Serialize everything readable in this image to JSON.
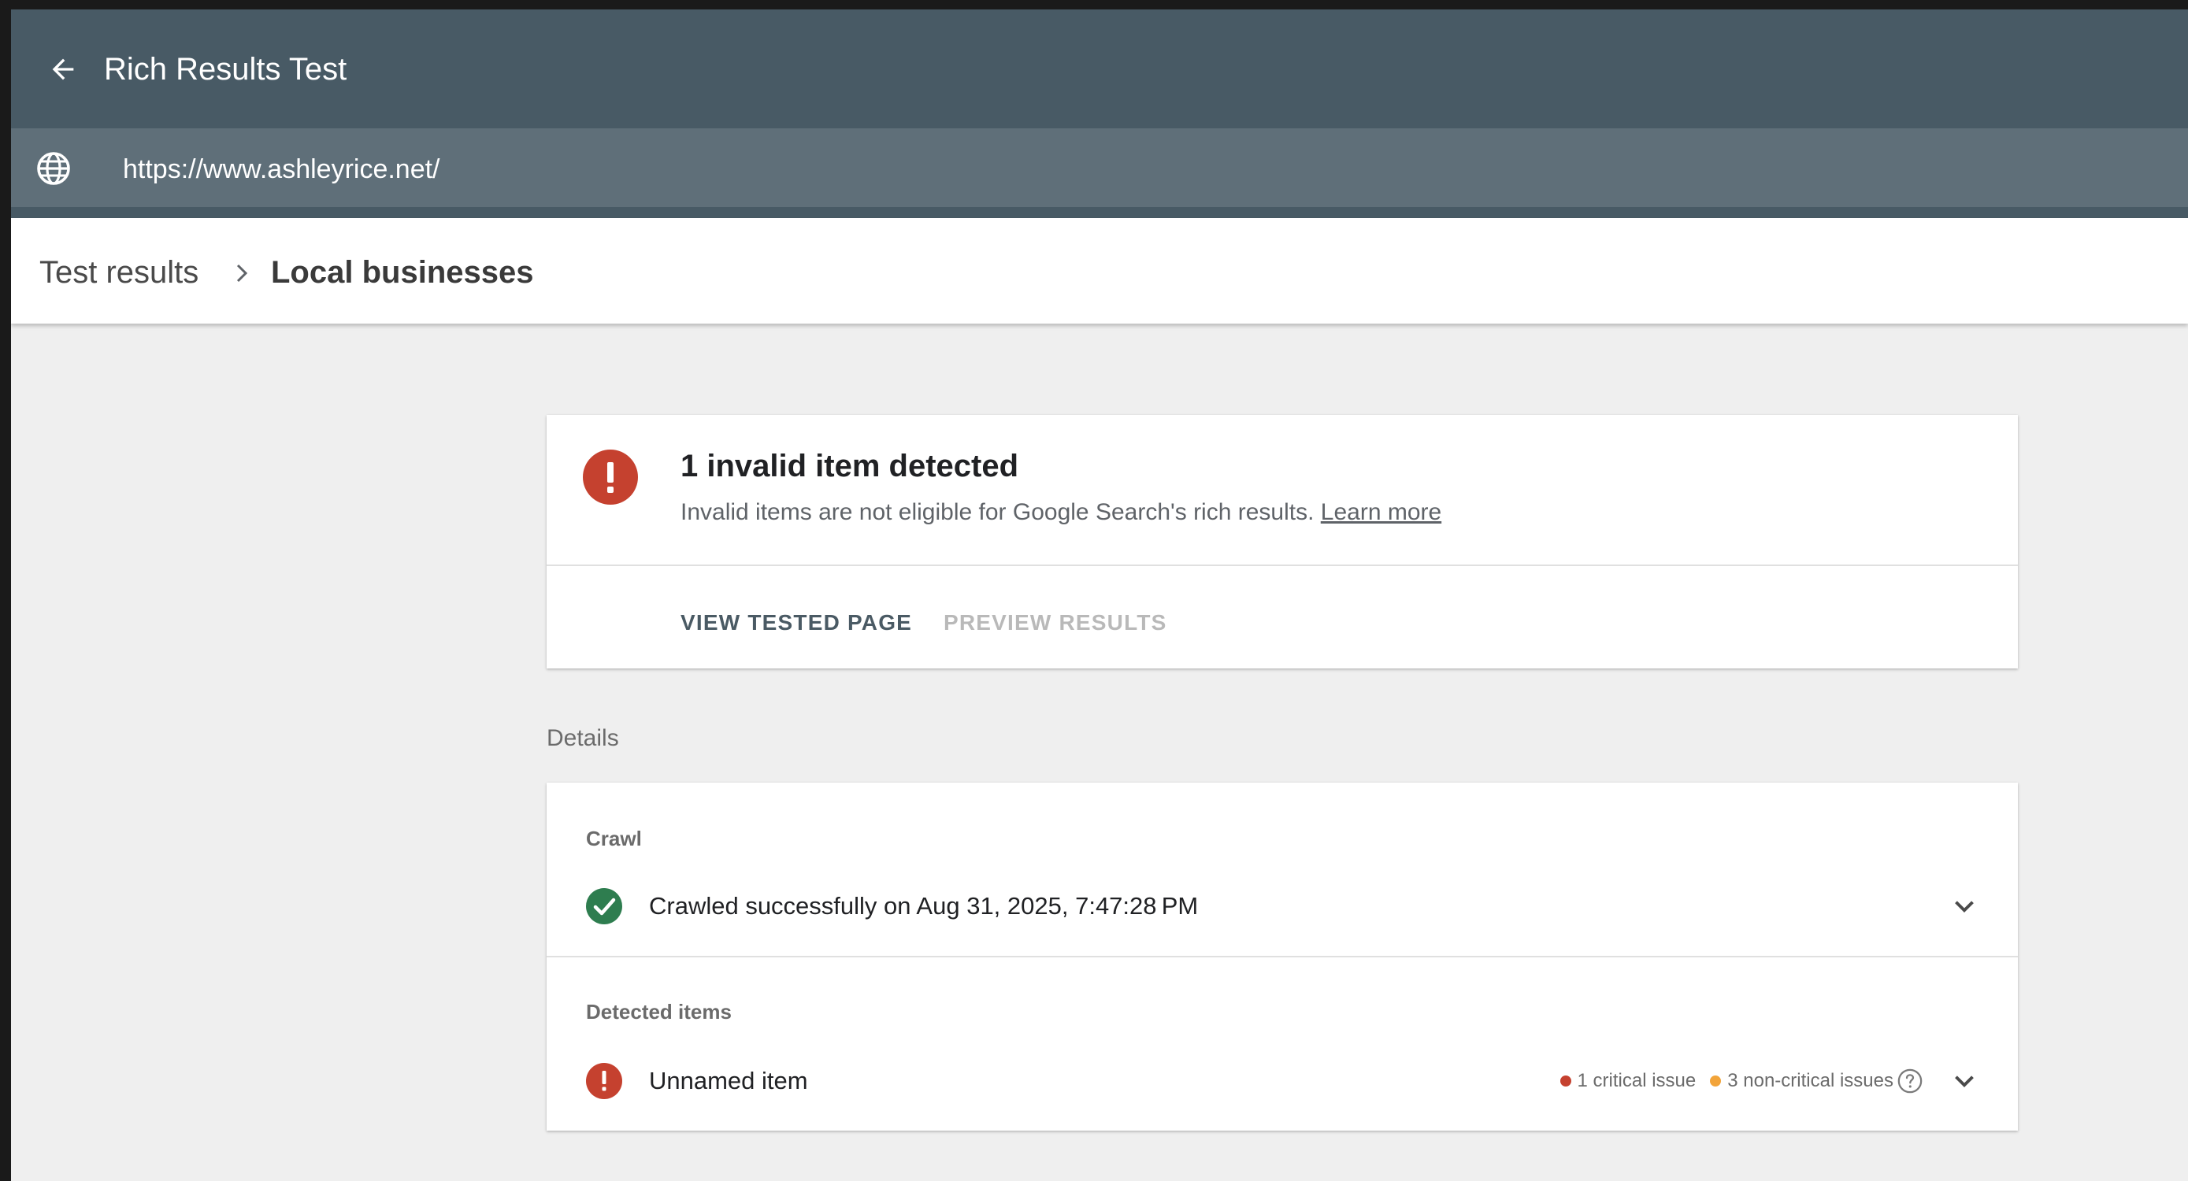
{
  "app": {
    "title": "Rich Results Test",
    "url": "https://www.ashleyrice.net/"
  },
  "breadcrumb": {
    "parent": "Test results",
    "current": "Local businesses"
  },
  "summary": {
    "title": "1 invalid item detected",
    "description": "Invalid items are not eligible for Google Search's rich results.",
    "learn_more": "Learn more",
    "view_tested_page": "VIEW TESTED PAGE",
    "preview_results": "PREVIEW RESULTS"
  },
  "details": {
    "label": "Details",
    "crawl": {
      "label": "Crawl",
      "status": "Crawled successfully on Aug 31, 2025, 7:47:28 PM"
    },
    "detected_items": {
      "label": "Detected items",
      "items": [
        {
          "name": "Unnamed item",
          "critical": "1 critical issue",
          "non_critical": "3 non-critical issues"
        }
      ]
    }
  },
  "colors": {
    "appbar": "#485a65",
    "urlbar": "#5f6f79",
    "error_red": "#c5412f",
    "success_green": "#2e7d4f",
    "warning_orange": "#f2a43a"
  },
  "icons": {
    "back": "arrow-back-icon",
    "url": "globe-icon",
    "breadcrumb_sep": "chevron-right-icon",
    "error": "error-icon",
    "success": "check-circle-icon",
    "expand": "chevron-down-icon",
    "help": "help-icon"
  }
}
